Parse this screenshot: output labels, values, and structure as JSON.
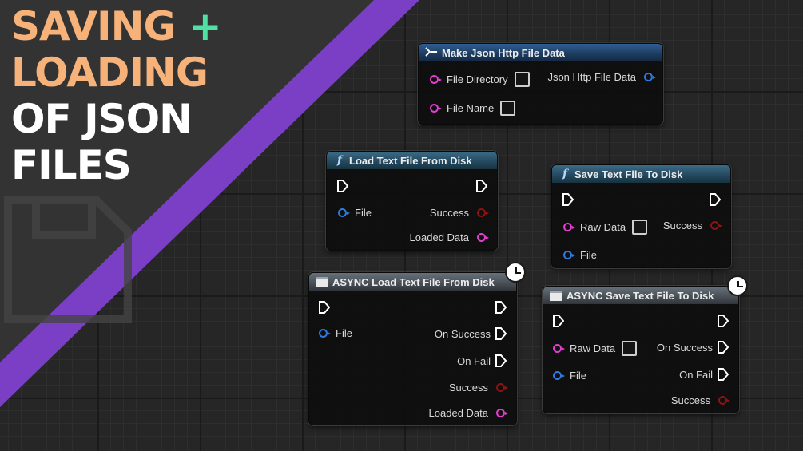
{
  "headline": {
    "line1": "SAVING",
    "plus": "+",
    "line2": "LOADING",
    "line3": "OF JSON",
    "line4": "FILES"
  },
  "colors": {
    "accent_orange": "#f7b27a",
    "accent_green": "#4fe0a3",
    "stripe_purple": "#7a3fc4",
    "pin_string": "#e23ed0",
    "pin_struct": "#2d7be0",
    "pin_bool": "#8a1414"
  },
  "nodes": {
    "make_json": {
      "title": "Make Json Http File Data",
      "icon": "make-struct-icon",
      "pin_file_directory": "File Directory",
      "pin_file_name": "File Name",
      "pin_output": "Json Http File Data"
    },
    "load_text": {
      "title": "Load Text File From Disk",
      "icon": "function-icon",
      "pin_file": "File",
      "pin_success": "Success",
      "pin_loaded_data": "Loaded Data"
    },
    "save_text": {
      "title": "Save Text File To Disk",
      "icon": "function-icon",
      "pin_raw_data": "Raw Data",
      "pin_file": "File",
      "pin_success": "Success"
    },
    "async_load": {
      "title": "ASYNC Load Text File From Disk",
      "icon": "async-node-icon",
      "pin_file": "File",
      "pin_on_success": "On Success",
      "pin_on_fail": "On Fail",
      "pin_success": "Success",
      "pin_loaded_data": "Loaded Data"
    },
    "async_save": {
      "title": "ASYNC Save Text File To Disk",
      "icon": "async-node-icon",
      "pin_raw_data": "Raw Data",
      "pin_file": "File",
      "pin_on_success": "On Success",
      "pin_on_fail": "On Fail",
      "pin_success": "Success"
    }
  }
}
